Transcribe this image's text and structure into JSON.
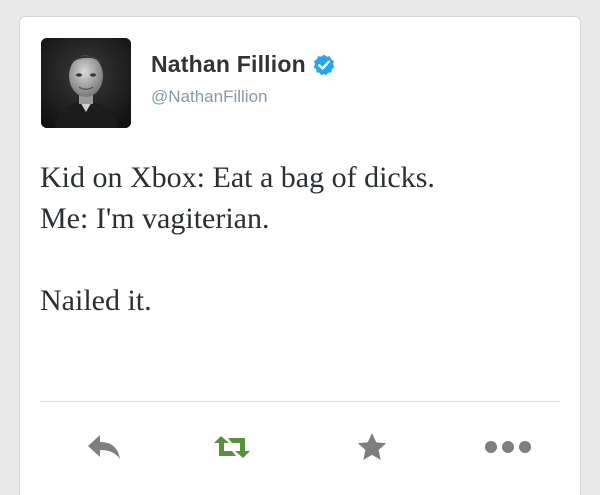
{
  "tweet": {
    "author": {
      "display_name": "Nathan Fillion",
      "handle": "@NathanFillion",
      "verified": true,
      "avatar_icon": "avatar-photo"
    },
    "lines": [
      "Kid on Xbox: Eat a bag of dicks.",
      "Me: I'm vagiterian.",
      "",
      "Nailed it."
    ],
    "actions": [
      {
        "name": "reply",
        "icon": "reply-arrow-icon"
      },
      {
        "name": "retweet",
        "icon": "retweet-icon"
      },
      {
        "name": "favorite",
        "icon": "star-icon"
      },
      {
        "name": "more",
        "icon": "more-dots-icon"
      }
    ]
  },
  "colors": {
    "card_bg": "#ffffff",
    "page_bg": "#e9e9e9",
    "verified_blue": "#2aa3ef",
    "retweet_green": "#5c913b",
    "icon_gray": "#7e7e7e",
    "name_text": "#333333",
    "handle_text": "#8899a6"
  }
}
